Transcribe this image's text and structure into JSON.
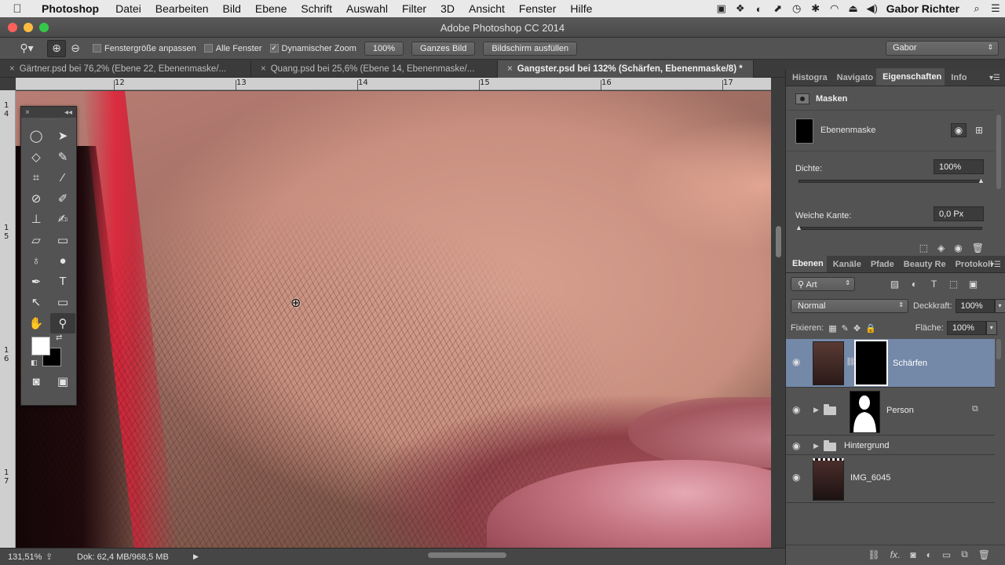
{
  "menubar": {
    "apple": "",
    "app": "Photoshop",
    "items": [
      "Datei",
      "Bearbeiten",
      "Bild",
      "Ebene",
      "Schrift",
      "Auswahl",
      "Filter",
      "3D",
      "Ansicht",
      "Fenster",
      "Hilfe"
    ],
    "user": "Gabor Richter"
  },
  "window": {
    "title": "Adobe Photoshop CC 2014"
  },
  "options": {
    "resize_label": "Fenstergröße anpassen",
    "all_windows_label": "Alle Fenster",
    "dynamic_zoom_label": "Dynamischer Zoom",
    "zoom_btn": "100%",
    "fit_btn": "Ganzes Bild",
    "fill_btn": "Bildschirm ausfüllen",
    "workspace": "Gabor"
  },
  "doc_tabs": [
    {
      "label": "Gärtner.psd bei 76,2% (Ebene 22, Ebenenmaske/..."
    },
    {
      "label": "Quang.psd bei 25,6% (Ebene 14, Ebenenmaske/..."
    },
    {
      "label": "Gangster.psd bei 132% (Schärfen, Ebenenmaske/8) *"
    }
  ],
  "ruler": {
    "h": [
      "12",
      "13",
      "14",
      "15",
      "16",
      "17"
    ],
    "v": [
      "1\n4",
      "1\n5",
      "1\n6",
      "1\n7"
    ]
  },
  "properties": {
    "tabs": [
      "Histogra",
      "Navigato",
      "Eigenschaften",
      "Info"
    ],
    "header": "Masken",
    "mask_label": "Ebenenmaske",
    "density_label": "Dichte:",
    "density_value": "100%",
    "feather_label": "Weiche Kante:",
    "feather_value": "0,0 Px"
  },
  "layers_panel": {
    "tabs": [
      "Ebenen",
      "Kanäle",
      "Pfade",
      "Beauty Re",
      "Protokoll"
    ],
    "filter_kind": "Art",
    "blend_mode": "Normal",
    "opacity_label": "Deckkraft:",
    "opacity_value": "100%",
    "lock_label": "Fixieren:",
    "fill_label": "Fläche:",
    "fill_value": "100%",
    "layers": [
      {
        "name": "Schärfen"
      },
      {
        "name": "Person"
      },
      {
        "name": "Hintergrund"
      },
      {
        "name": "IMG_6045"
      }
    ]
  },
  "status": {
    "zoom": "131,51%",
    "doc": "Dok: 62,4 MB/968,5 MB"
  }
}
